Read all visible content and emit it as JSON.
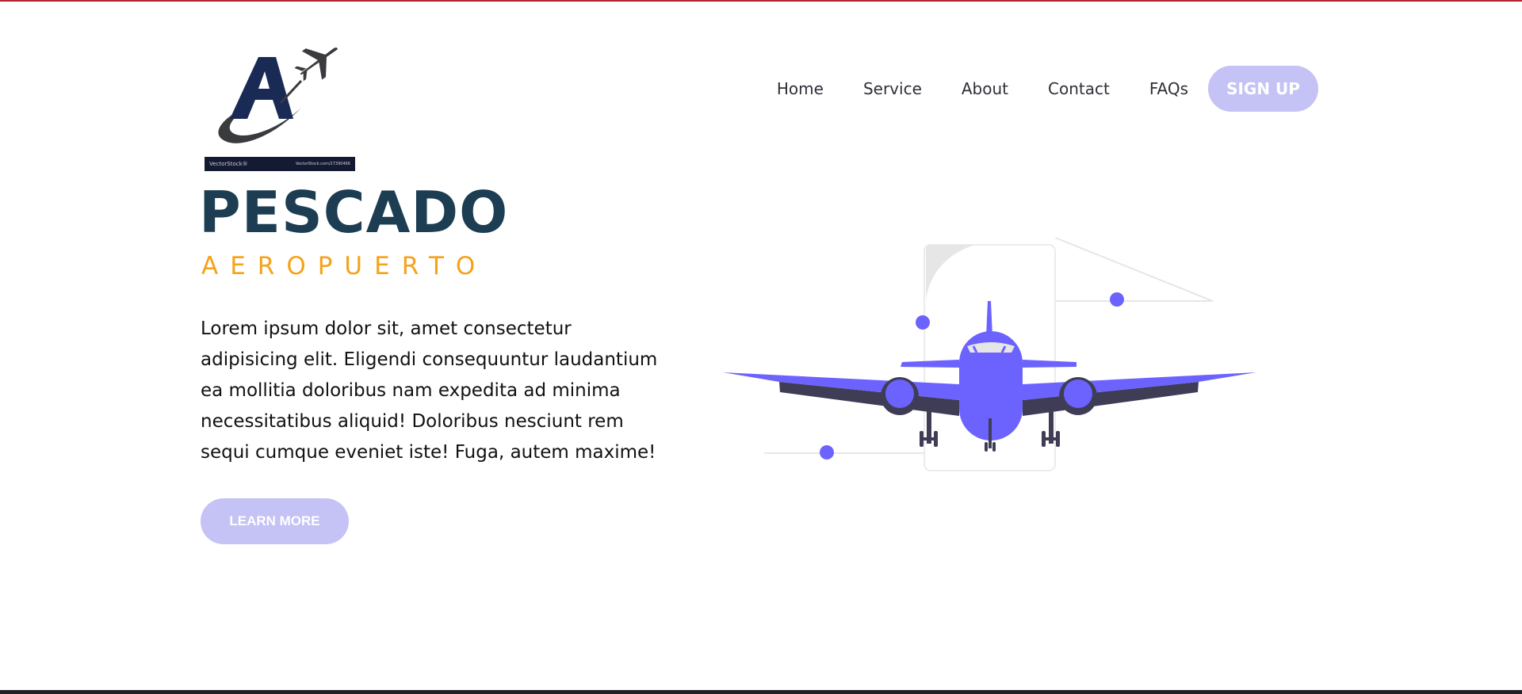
{
  "colors": {
    "accent": "#c5c2f5",
    "plane": "#6c63ff",
    "title": "#1c3d52",
    "subtitle": "#f5a21c",
    "top_line": "#b3262e"
  },
  "logo": {
    "icon": "airplane-logo-icon",
    "watermark_left": "VectorStock®",
    "watermark_right": "VectorStock.com/27390466"
  },
  "nav": {
    "items": [
      {
        "label": "Home"
      },
      {
        "label": "Service"
      },
      {
        "label": "About"
      },
      {
        "label": "Contact"
      },
      {
        "label": "FAQs"
      }
    ],
    "signup_label": "SIGN UP"
  },
  "hero": {
    "title": "PESCADO",
    "subtitle": "AEROPUERTO",
    "body": "Lorem ipsum dolor sit, amet consectetur adipisicing elit. Eligendi consequuntur laudantium ea mollitia doloribus nam expedita ad minima necessitatibus aliquid! Doloribus nesciunt rem sequi cumque eveniet iste! Fuga, autem maxime!",
    "button_label": "LEARN MORE"
  },
  "illustration": {
    "icon": "airplane-illustration-icon"
  }
}
